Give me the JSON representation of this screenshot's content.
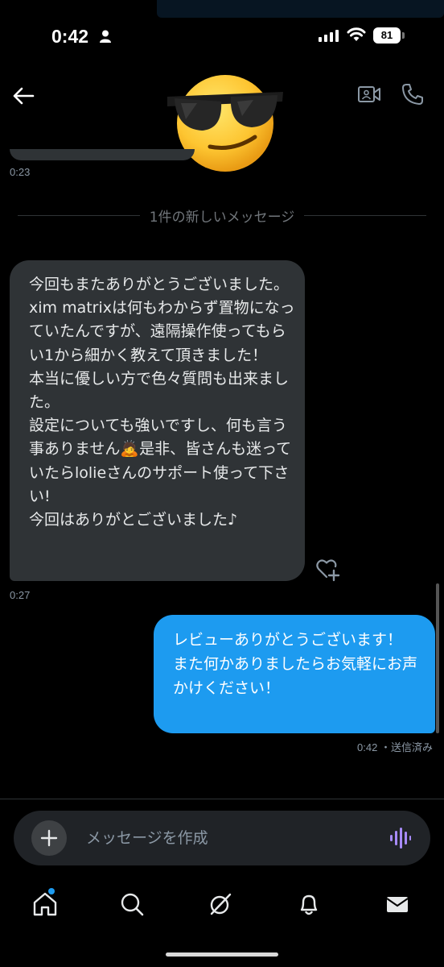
{
  "status_bar": {
    "time": "0:42",
    "battery": "81"
  },
  "header": {
    "avatar_emoji": "😎"
  },
  "messages": {
    "prev_time": "0:23",
    "divider": "1件の新しいメッセージ",
    "incoming": {
      "text": "今回もまたありがとうございました。\nxim matrixは何もわからず置物になっていたんですが、遠隔操作使ってもらい1から細かく教えて頂きました！\n本当に優しい方で色々質問も出来ました。\n設定についても強いですし、何も言う事ありません🙇是非、皆さんも迷っていたらlolieさんのサポート使って下さい!\n今回はありがとございました♪",
      "time": "0:27"
    },
    "outgoing": {
      "text": "レビューありがとうございます！\nまた何かありましたらお気軽にお声かけください！",
      "time": "0:42",
      "status": "・送信済み"
    }
  },
  "composer": {
    "placeholder": "メッセージを作成"
  },
  "colors": {
    "accent": "#1d9bf0",
    "incoming_bubble": "#2f3336",
    "voice_icon": "#a78bfa"
  },
  "nav_icons": [
    "home-icon",
    "search-icon",
    "grok-icon",
    "notifications-icon",
    "messages-icon"
  ]
}
